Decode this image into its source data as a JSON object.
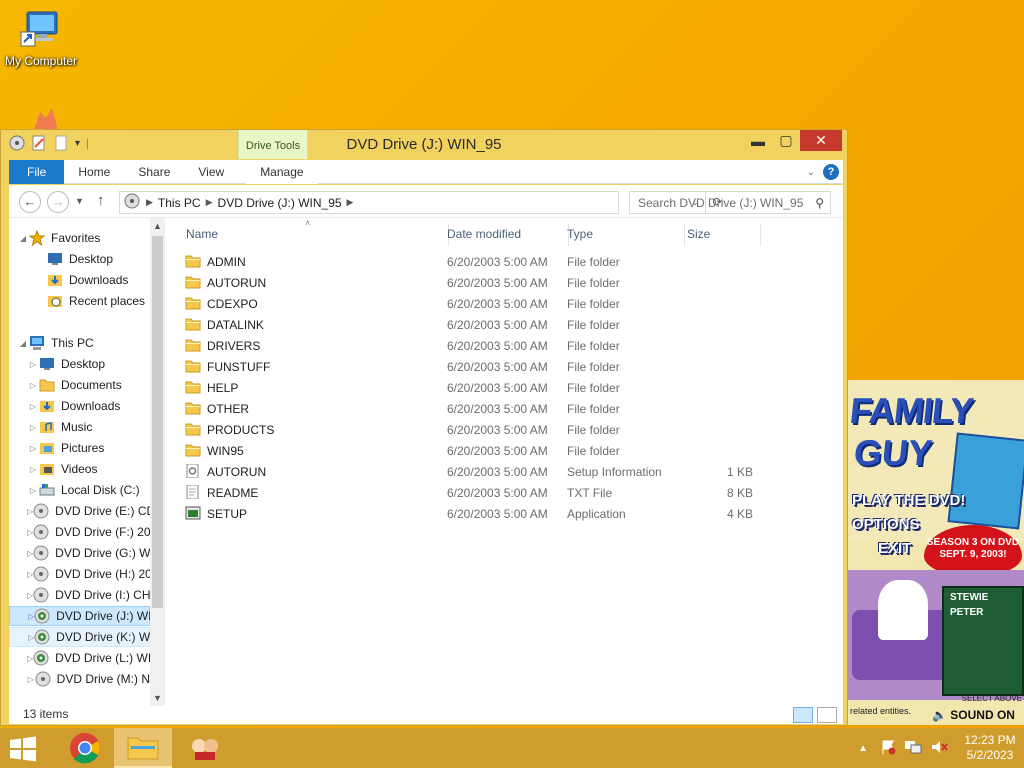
{
  "desktop": {
    "icon_label": "My Computer"
  },
  "window": {
    "title": "DVD Drive (J:) WIN_95",
    "context_tab": "Drive Tools",
    "buttons": {
      "minimize": "▬",
      "maximize": "▢",
      "close": "✕"
    }
  },
  "ribbon": {
    "tabs": [
      "File",
      "Home",
      "Share",
      "View",
      "Manage"
    ]
  },
  "address": {
    "segments": [
      "This PC",
      "DVD Drive (J:) WIN_95"
    ],
    "search_placeholder": "Search DVD Drive (J:) WIN_95"
  },
  "nav": {
    "favorites_label": "Favorites",
    "favorites": [
      "Desktop",
      "Downloads",
      "Recent places"
    ],
    "thispc_label": "This PC",
    "thispc": [
      "Desktop",
      "Documents",
      "Downloads",
      "Music",
      "Pictures",
      "Videos",
      "Local Disk (C:)",
      "DVD Drive (E:) CD",
      "DVD Drive (F:) 20",
      "DVD Drive (G:) W",
      "DVD Drive (H:) 20",
      "DVD Drive (I:) CH",
      "DVD Drive (J:) WI",
      "DVD Drive (K:) W",
      "DVD Drive (L:) WI",
      "DVD Drive (M:) N"
    ]
  },
  "columns": {
    "name": "Name",
    "date": "Date modified",
    "type": "Type",
    "size": "Size"
  },
  "files": [
    {
      "name": "ADMIN",
      "date": "6/20/2003 5:00 AM",
      "type": "File folder",
      "size": "",
      "icon": "folder-icon"
    },
    {
      "name": "AUTORUN",
      "date": "6/20/2003 5:00 AM",
      "type": "File folder",
      "size": "",
      "icon": "folder-icon"
    },
    {
      "name": "CDEXPO",
      "date": "6/20/2003 5:00 AM",
      "type": "File folder",
      "size": "",
      "icon": "folder-icon"
    },
    {
      "name": "DATALINK",
      "date": "6/20/2003 5:00 AM",
      "type": "File folder",
      "size": "",
      "icon": "folder-icon"
    },
    {
      "name": "DRIVERS",
      "date": "6/20/2003 5:00 AM",
      "type": "File folder",
      "size": "",
      "icon": "folder-icon"
    },
    {
      "name": "FUNSTUFF",
      "date": "6/20/2003 5:00 AM",
      "type": "File folder",
      "size": "",
      "icon": "folder-icon"
    },
    {
      "name": "HELP",
      "date": "6/20/2003 5:00 AM",
      "type": "File folder",
      "size": "",
      "icon": "folder-icon"
    },
    {
      "name": "OTHER",
      "date": "6/20/2003 5:00 AM",
      "type": "File folder",
      "size": "",
      "icon": "folder-icon"
    },
    {
      "name": "PRODUCTS",
      "date": "6/20/2003 5:00 AM",
      "type": "File folder",
      "size": "",
      "icon": "folder-icon"
    },
    {
      "name": "WIN95",
      "date": "6/20/2003 5:00 AM",
      "type": "File folder",
      "size": "",
      "icon": "folder-icon"
    },
    {
      "name": "AUTORUN",
      "date": "6/20/2003 5:00 AM",
      "type": "Setup Information",
      "size": "1 KB",
      "icon": "setup-info-icon"
    },
    {
      "name": "README",
      "date": "6/20/2003 5:00 AM",
      "type": "TXT File",
      "size": "8 KB",
      "icon": "text-file-icon"
    },
    {
      "name": "SETUP",
      "date": "6/20/2003 5:00 AM",
      "type": "Application",
      "size": "4 KB",
      "icon": "application-icon"
    }
  ],
  "status": {
    "items": "13 items"
  },
  "splash": {
    "title1": "FAMILY",
    "title2": "GUY",
    "opt1": "PLAY THE DVD!",
    "opt2": "OPTIONS",
    "opt3": "EXIT",
    "badge": "SEASON 3 ON DVD SEPT. 9, 2003!",
    "menu1": "STEWIE",
    "menu2": "PETER",
    "footer": "related entities.",
    "select": "SELECT ABOVE",
    "sound": "SOUND ON"
  },
  "taskbar": {
    "time": "12:23 PM",
    "date": "5/2/2023"
  },
  "colors": {
    "accent": "#1979ca",
    "close": "#c7392d",
    "window_frame": "#f1d25e",
    "taskbar": "#cf9d2d"
  }
}
